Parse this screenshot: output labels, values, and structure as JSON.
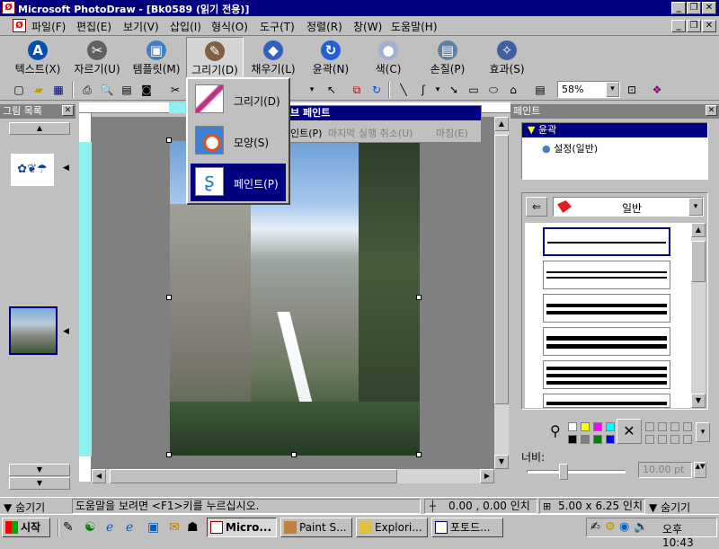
{
  "window": {
    "title": "Microsoft PhotoDraw - [Bk0589 (읽기 전용)]",
    "min": "_",
    "restore": "❐",
    "close": "✕"
  },
  "menu": [
    "파일(F)",
    "편집(E)",
    "보기(V)",
    "삽입(I)",
    "형식(O)",
    "도구(T)",
    "정렬(R)",
    "창(W)",
    "도움말(H)"
  ],
  "bigtoolbar": [
    {
      "label": "텍스트(X)",
      "icon": "A",
      "color": "#0050b0"
    },
    {
      "label": "자르기(U)",
      "icon": "✂",
      "color": "#606060"
    },
    {
      "label": "템플릿(M)",
      "icon": "▣",
      "color": "#4080c0"
    },
    {
      "label": "그리기(D)",
      "icon": "✎",
      "color": "#806040"
    },
    {
      "label": "채우기(L)",
      "icon": "◆",
      "color": "#3060c0"
    },
    {
      "label": "윤곽(N)",
      "icon": "↻",
      "color": "#2060d0"
    },
    {
      "label": "색(C)",
      "icon": "●",
      "color": "#a0b0d0"
    },
    {
      "label": "손질(P)",
      "icon": "▤",
      "color": "#6080a0"
    },
    {
      "label": "효과(S)",
      "icon": "✧",
      "color": "#4060a0"
    }
  ],
  "toolbar": {
    "zoom": "58%"
  },
  "leftpanel": {
    "title": "그림 목록",
    "thumb1_text": "✿❦☂"
  },
  "dropdown": {
    "items": [
      {
        "label": "그리기(D)"
      },
      {
        "label": "모양(S)"
      },
      {
        "label": "페인트(P)"
      }
    ]
  },
  "subpanel": {
    "title": "브 페인트",
    "row": [
      "인트(P)",
      "마지막 실행 취소(U)",
      "마침(E)"
    ]
  },
  "rightpanel": {
    "title": "페인트",
    "tree_root": "윤곽",
    "tree_child": "설정(일반)",
    "category": "일반",
    "width_label": "너비:",
    "width_value": "10.00 pt"
  },
  "palette_colors": [
    "#ffffff",
    "#ffff00",
    "#ff00ff",
    "#00ffff",
    "#000000",
    "#808080",
    "#008000",
    "#0000ff",
    "#ff0000"
  ],
  "status": {
    "hide1": "숨기기",
    "help": "도움말을 보려면 <F1>키를 누르십시오.",
    "coords": "0.00 , 0.00 인치",
    "size": "5.00 x 6.25 인치",
    "hide2": "숨기기"
  },
  "taskbar": {
    "start": "시작",
    "tasks": [
      "Micro...",
      "Paint S...",
      "Explori...",
      "포토드..."
    ],
    "clock": "오후 10:43"
  }
}
